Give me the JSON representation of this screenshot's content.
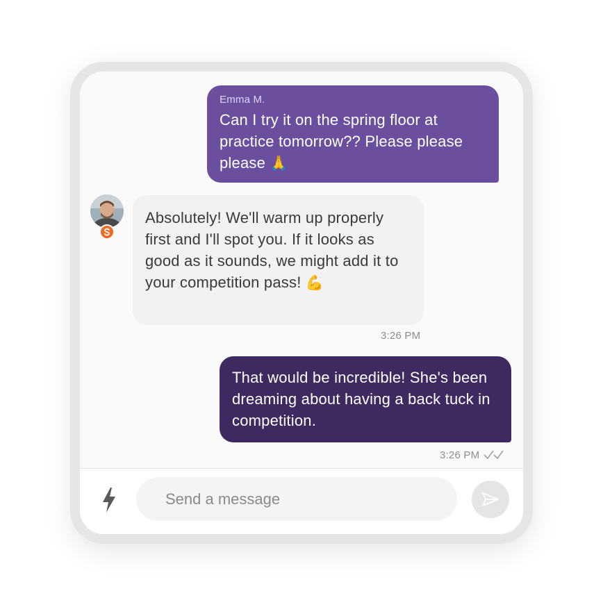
{
  "messages": [
    {
      "direction": "outgoing",
      "sender": "Emma M.",
      "text": "Can I try it on the spring floor at practice tomorrow?? Please please please",
      "emoji": "🙏"
    },
    {
      "direction": "incoming",
      "avatar": "coach-avatar",
      "text": "Absolutely! We'll warm up properly first and I'll spot you. If it looks as good as it sounds, we might add it to your competition pass!",
      "emoji": "💪",
      "time": "3:26 PM"
    },
    {
      "direction": "outgoing",
      "text": "That would be incredible! She's been dreaming about having a back tuck in competition.",
      "time": "3:26 PM",
      "status_icon": "double-check-icon"
    }
  ],
  "composer": {
    "placeholder": "Send a message",
    "left_icon": "lightning-icon",
    "send_icon": "send-icon"
  },
  "colors": {
    "outgoing_primary": "#6b4f9e",
    "outgoing_dark": "#3e2961",
    "incoming_bg": "#f2f2f2",
    "badge": "#f26a21"
  }
}
